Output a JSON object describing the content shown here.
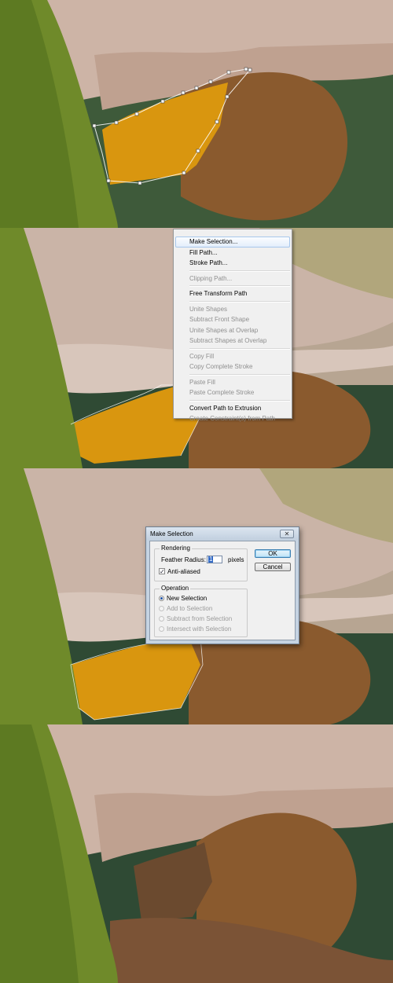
{
  "context_menu": {
    "items": [
      {
        "label": "Make Selection...",
        "enabled": true,
        "highlighted": true
      },
      {
        "label": "Fill Path...",
        "enabled": true
      },
      {
        "label": "Stroke Path...",
        "enabled": true
      },
      {
        "label": "Clipping Path...",
        "enabled": false
      },
      {
        "label": "Free Transform Path",
        "enabled": true
      },
      {
        "label": "Unite Shapes",
        "enabled": false
      },
      {
        "label": "Subtract Front Shape",
        "enabled": false
      },
      {
        "label": "Unite Shapes at Overlap",
        "enabled": false
      },
      {
        "label": "Subtract Shapes at Overlap",
        "enabled": false
      },
      {
        "label": "Copy Fill",
        "enabled": false
      },
      {
        "label": "Copy Complete Stroke",
        "enabled": false
      },
      {
        "label": "Paste Fill",
        "enabled": false
      },
      {
        "label": "Paste Complete Stroke",
        "enabled": false
      },
      {
        "label": "Convert Path to Extrusion",
        "enabled": true
      },
      {
        "label": "Create Constraint(s) from Path",
        "enabled": false
      }
    ]
  },
  "dialog": {
    "title": "Make Selection",
    "close_glyph": "✕",
    "rendering": {
      "legend": "Rendering",
      "feather_label": "Feather Radius:",
      "feather_value": "1",
      "feather_unit": "pixels",
      "antialiased_label": "Anti-aliased",
      "antialiased_checked": true
    },
    "operation": {
      "legend": "Operation",
      "options": [
        {
          "label": "New Selection",
          "selected": true,
          "enabled": true
        },
        {
          "label": "Add to Selection",
          "selected": false,
          "enabled": false
        },
        {
          "label": "Subtract from Selection",
          "selected": false,
          "enabled": false
        },
        {
          "label": "Intersect with Selection",
          "selected": false,
          "enabled": false
        }
      ]
    },
    "ok_label": "OK",
    "cancel_label": "Cancel"
  },
  "colors": {
    "leaf_green": "#6f8a2a",
    "petal_pink": "#c9b2a3",
    "lip_orange": "#d9960f",
    "lip_brown": "#8a5a2e",
    "bg_dark_green": "#2f4a34",
    "menu_highlight": "#e3eefb"
  },
  "icons": {
    "close": "close-icon",
    "check": "checkmark-icon",
    "radio": "radio-icon"
  }
}
